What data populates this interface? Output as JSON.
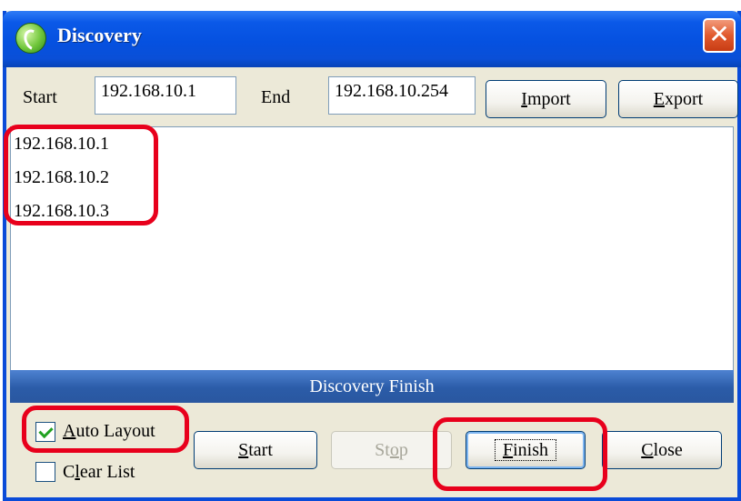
{
  "window": {
    "title": "Discovery",
    "close_symbol": "✕"
  },
  "range": {
    "start_label": "Start",
    "start_value": "192.168.10.1",
    "end_label": "End",
    "end_value": "192.168.10.254",
    "import_label": "Import",
    "import_accesskey": "I",
    "import_rest": "mport",
    "export_label": "Export",
    "export_accesskey": "E",
    "export_rest": "xport"
  },
  "discovered": [
    "192.168.10.1",
    "192.168.10.2",
    "192.168.10.3"
  ],
  "status": "Discovery Finish",
  "options": {
    "auto_layout_label": "Auto Layout",
    "auto_layout_accesskey": "A",
    "auto_layout_rest": "uto Layout",
    "auto_layout_checked": true,
    "clear_list_label": "Clear List",
    "clear_list_pre": "C",
    "clear_list_accesskey": "l",
    "clear_list_rest": "ear List",
    "clear_list_checked": false
  },
  "buttons": {
    "start": {
      "label": "Start",
      "accesskey": "S",
      "rest": "tart"
    },
    "stop": {
      "label": "Stop",
      "pre": "St",
      "accesskey": "o",
      "rest": "p",
      "disabled": true
    },
    "finish": {
      "label": "Finish",
      "accesskey": "F",
      "rest": "inish"
    },
    "close": {
      "label": "Close",
      "accesskey": "C",
      "rest": "lose"
    }
  },
  "colors": {
    "highlight": "#e8001c",
    "titlebar": "#0551e0",
    "status_bar": "#2b5ca8"
  }
}
